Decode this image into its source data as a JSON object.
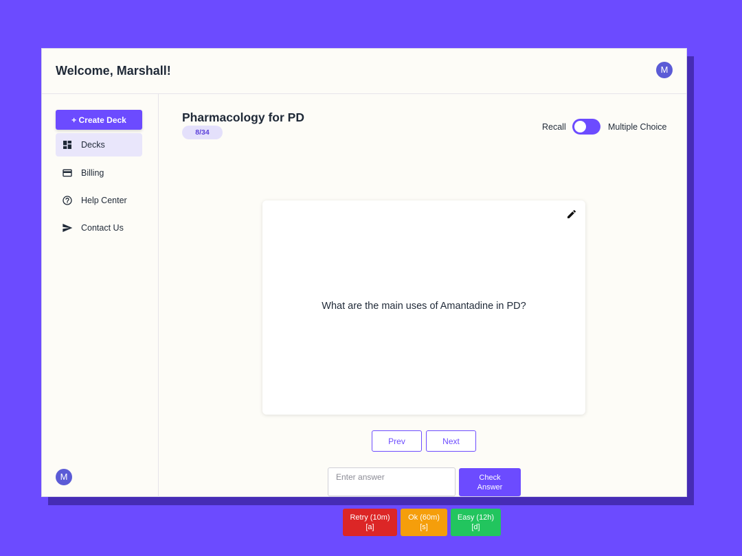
{
  "header": {
    "title": "Welcome, Marshall!",
    "avatar_initial": "M"
  },
  "sidebar": {
    "create_label": "+ Create Deck",
    "items": [
      {
        "label": "Decks",
        "icon": "dashboard-icon",
        "active": true
      },
      {
        "label": "Billing",
        "icon": "credit-card-icon"
      },
      {
        "label": "Help Center",
        "icon": "help-circle-icon"
      },
      {
        "label": "Contact Us",
        "icon": "send-icon"
      }
    ],
    "avatar_initial": "M"
  },
  "deck": {
    "title": "Pharmacology for PD",
    "progress": "8/34"
  },
  "mode": {
    "left_label": "Recall",
    "right_label": "Multiple Choice",
    "selected": "Recall"
  },
  "card": {
    "question": "What are the main uses of Amantadine in PD?",
    "edit_icon": "pencil-icon"
  },
  "navigation": {
    "prev_label": "Prev",
    "next_label": "Next"
  },
  "answer": {
    "placeholder": "Enter answer",
    "value": "",
    "check_label_line1": "Check",
    "check_label_line2": "Answer"
  },
  "grades": [
    {
      "label": "Retry (10m)",
      "key": "[a]",
      "color": "#dc2626"
    },
    {
      "label": "Ok (60m)",
      "key": "[s]",
      "color": "#f59e0b"
    },
    {
      "label": "Easy (12h)",
      "key": "[d]",
      "color": "#22c55e"
    }
  ],
  "colors": {
    "accent": "#6c4bff",
    "background": "#6c4bff",
    "panel": "#fdfcf7"
  }
}
